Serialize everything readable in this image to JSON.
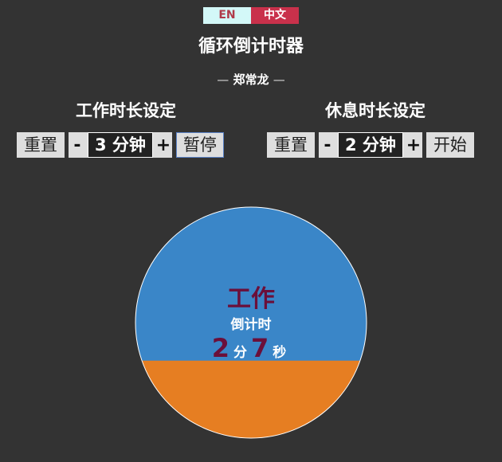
{
  "lang": {
    "en_label": "EN",
    "zh_label": "中文"
  },
  "title": "循环倒计时器",
  "author": {
    "dash_left": "—",
    "name": "郑常龙",
    "dash_right": "—"
  },
  "work": {
    "heading": "工作时长设定",
    "reset_label": "重置",
    "minus_label": "-",
    "value": "3 分钟",
    "plus_label": "+",
    "action_label": "暂停"
  },
  "break": {
    "heading": "休息时长设定",
    "reset_label": "重置",
    "minus_label": "-",
    "value": "2 分钟",
    "plus_label": "+",
    "action_label": "开始"
  },
  "timer": {
    "mode": "工作",
    "subtitle": "倒计时",
    "minutes": "2",
    "minutes_unit": "分",
    "seconds": "7",
    "seconds_unit": "秒",
    "remaining_fraction": 0.706,
    "colors": {
      "remaining": "#3a86c8",
      "elapsed": "#e67e22",
      "border": "#ffffff"
    }
  }
}
